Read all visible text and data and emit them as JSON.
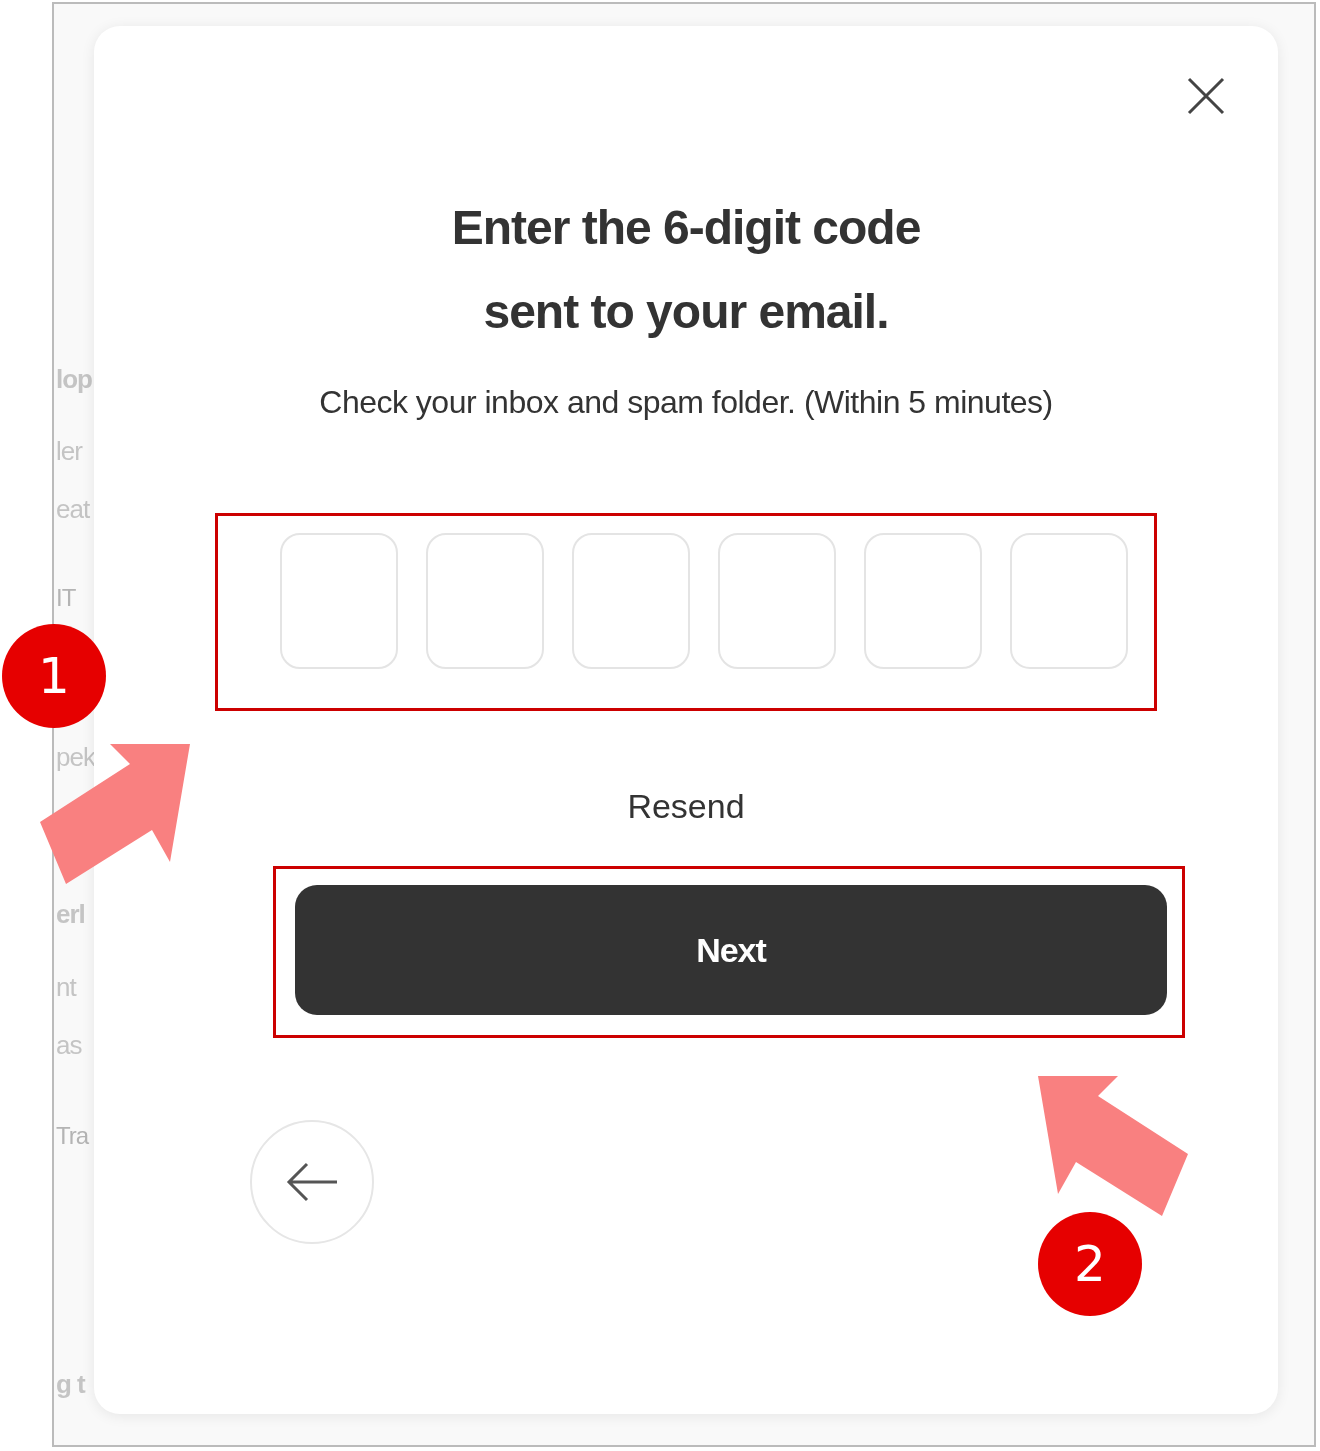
{
  "background_fragments": [
    {
      "text": "lop",
      "kind": "heading"
    },
    {
      "text": "ler",
      "kind": "body"
    },
    {
      "text": "eat",
      "kind": "body"
    },
    {
      "text": "IT",
      "kind": "small"
    },
    {
      "text": "pek",
      "kind": "body"
    },
    {
      "text": "erl",
      "kind": "heading"
    },
    {
      "text": "nt",
      "kind": "body"
    },
    {
      "text": "as",
      "kind": "body"
    },
    {
      "text": "Tra",
      "kind": "small"
    },
    {
      "text": "g t",
      "kind": "heading"
    }
  ],
  "dialog": {
    "title_lines": [
      "Enter the 6-digit code",
      "sent to your email."
    ],
    "subtitle": "Check your inbox and spam folder. (Within 5 minutes)",
    "code_boxes": [
      {
        "filled": false
      },
      {
        "filled": false
      },
      {
        "filled": false
      },
      {
        "filled": false
      },
      {
        "filled": false
      },
      {
        "filled": false
      }
    ],
    "resend_link": "Resend",
    "next_button": "Next"
  },
  "annotations": [
    {
      "number": "1"
    },
    {
      "number": "2"
    }
  ]
}
